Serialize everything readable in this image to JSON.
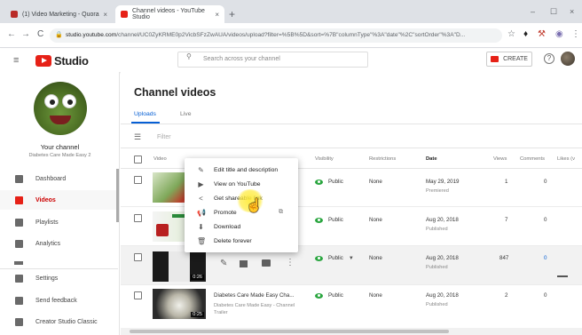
{
  "browser": {
    "tabs": [
      {
        "label": "(1) Video Marketing - Quora",
        "close": "×",
        "favicon_color": "#b92b27"
      },
      {
        "label": "Channel videos - YouTube Studio",
        "close": "×",
        "favicon_color": "#e62117"
      }
    ],
    "new_tab": "+",
    "window_controls": [
      "–",
      "☐",
      "×"
    ],
    "nav": [
      "←",
      "→",
      "C"
    ],
    "url_host": "studio.youtube.com",
    "url_path": "/channel/UC0ZyKRME0p2VicbSFzZwAUA/videos/upload?filter=%5B%5D&sort=%7B\"columnType\"%3A\"date\"%2C\"sortOrder\"%3A\"D...",
    "ext_icons": [
      "☆",
      "♦",
      "⚒",
      "◉",
      "⋮"
    ]
  },
  "header": {
    "menu_icon": "≡",
    "logo_text": "Studio",
    "search_placeholder": "Search across your channel",
    "search_icon": "🔍",
    "create_label": "CREATE",
    "help_icon": "?"
  },
  "sidebar": {
    "your_channel": "Your channel",
    "channel_name": "Diabetes Care Made Easy 2",
    "items": [
      {
        "label": "Dashboard",
        "active": false
      },
      {
        "label": "Videos",
        "active": true
      },
      {
        "label": "Playlists",
        "active": false
      },
      {
        "label": "Analytics",
        "active": false
      },
      {
        "label": "Settings",
        "active": false
      },
      {
        "label": "Send feedback",
        "active": false
      },
      {
        "label": "Creator Studio Classic",
        "active": false
      }
    ]
  },
  "main": {
    "title": "Channel videos",
    "tabs": [
      "Uploads",
      "Live"
    ],
    "filter_placeholder": "Filter",
    "columns": [
      "Video",
      "Visibility",
      "Restrictions",
      "Date",
      "Views",
      "Comments",
      "Likes (v"
    ],
    "rows": [
      {
        "title": "",
        "desc": "",
        "visibility": "Public",
        "restrictions": "None",
        "date": "May 29, 2019",
        "status": "Premiered",
        "views": "1",
        "comments": "0",
        "duration": ""
      },
      {
        "title": "",
        "desc": "",
        "visibility": "Public",
        "restrictions": "None",
        "date": "Aug 20, 2018",
        "status": "Published",
        "views": "7",
        "comments": "0",
        "duration": ""
      },
      {
        "title": "",
        "desc": "",
        "visibility": "Public",
        "restrictions": "None",
        "date": "Aug 20, 2018",
        "status": "Published",
        "views": "847",
        "comments": "0",
        "duration": "0:26"
      },
      {
        "title": "Diabetes Care Made Easy Cha...",
        "desc": "Diabetes Care Made Easy - Channel Trailer",
        "visibility": "Public",
        "restrictions": "None",
        "date": "Aug 20, 2018",
        "status": "Published",
        "views": "2",
        "comments": "0",
        "duration": "0:25"
      }
    ]
  },
  "context_menu": {
    "items": [
      {
        "label": "Edit title and description",
        "icon": "✎"
      },
      {
        "label": "View on YouTube",
        "icon": "▶"
      },
      {
        "label": "Get shareable link",
        "icon": "<"
      },
      {
        "label": "Promote",
        "icon": "📢"
      },
      {
        "label": "Download",
        "icon": "⬇"
      },
      {
        "label": "Delete forever",
        "icon": "🗑"
      }
    ]
  },
  "colors": {
    "accent": "#065fd4",
    "brand": "#e62117",
    "public": "#2ba640"
  }
}
